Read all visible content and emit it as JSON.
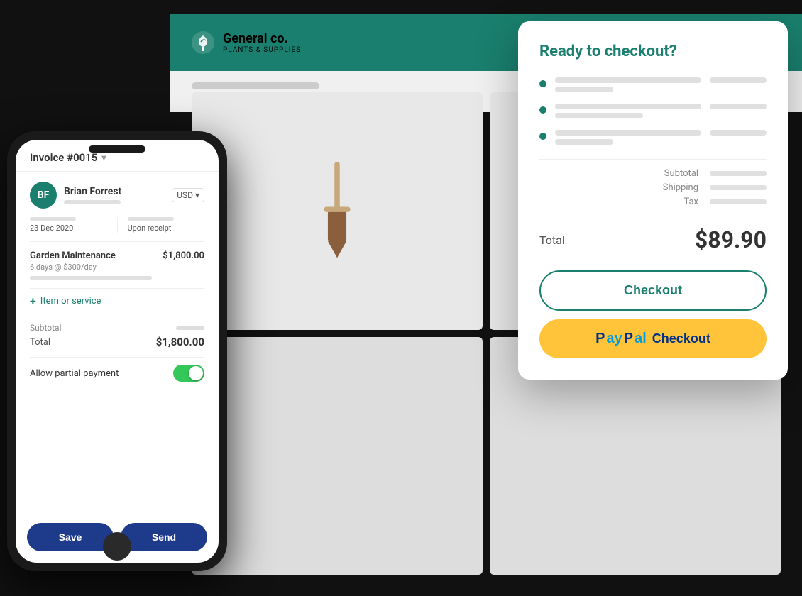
{
  "app": {
    "header": {
      "logo_text": "General co.",
      "logo_sub": "PLANTS & SUPPLIES"
    }
  },
  "invoice": {
    "title": "Invoice #0015",
    "customer_name": "Brian Forrest",
    "currency": "USD",
    "date": "23 Dec 2020",
    "due": "Upon receipt",
    "line_item_name": "Garden Maintenance",
    "line_item_price": "$1,800.00",
    "line_item_desc": "6 days @ $300/day",
    "add_item_label": "Item or service",
    "subtotal_label": "Subtotal",
    "total_label": "Total",
    "total_amount": "$1,800.00",
    "partial_payment_label": "Allow partial payment",
    "save_label": "Save",
    "send_label": "Send"
  },
  "checkout": {
    "title": "Ready to checkout?",
    "subtotal_label": "Subtotal",
    "shipping_label": "Shipping",
    "tax_label": "Tax",
    "total_label": "Total",
    "total_amount": "$89.90",
    "checkout_btn_label": "Checkout",
    "paypal_checkout_label": "Checkout",
    "paypal_text": "PayPal"
  }
}
